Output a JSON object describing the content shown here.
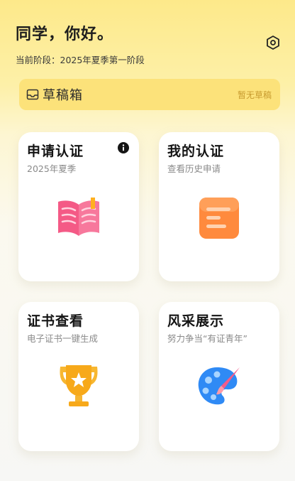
{
  "header": {
    "greeting": "同学，你好。",
    "phase": "当前阶段：2025年夏季第一阶段"
  },
  "drafts": {
    "title": "草稿箱",
    "status": "暂无草稿"
  },
  "cards": [
    {
      "title": "申请认证",
      "subtitle": "2025年夏季",
      "icon": "open-book-icon"
    },
    {
      "title": "我的认证",
      "subtitle": "查看历史申请",
      "icon": "document-icon"
    },
    {
      "title": "证书查看",
      "subtitle": "电子证书一键生成",
      "icon": "trophy-icon"
    },
    {
      "title": "风采展示",
      "subtitle": "努力争当“有证青年”",
      "icon": "palette-icon"
    }
  ],
  "colors": {
    "accent": "#fde98a",
    "drafts_bg": "#fce27a",
    "book": "#f45a86",
    "doc": "#ff8a3d",
    "trophy": "#f7a91a",
    "palette": "#2f8af5"
  }
}
